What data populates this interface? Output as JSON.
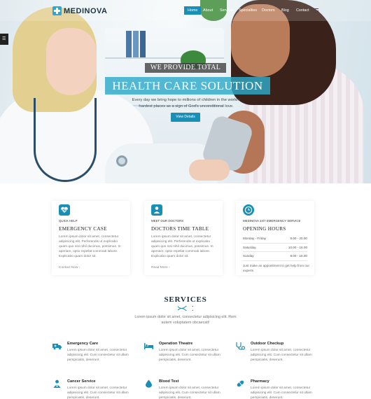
{
  "nav": {
    "logo": "MEDINOVA",
    "items": [
      "Home",
      "About",
      "Services",
      "Specialties",
      "Doctors",
      "Blog",
      "Contact"
    ],
    "active_index": 0
  },
  "hero": {
    "subtitle": "WE PROVIDE TOTAL",
    "title": "HEALTH CARE SOLUTION",
    "description": "Every day we bring hope to millions of children in the world's hardest places as a sign of God's unconditional love.",
    "button": "View Details"
  },
  "cards": [
    {
      "eyebrow": "QUICK HELP",
      "title": "EMERGENCY CASE",
      "text": "Lorem ipsum dolor sit amet, consectetur adipisicing elit. Perferendis ut explicabo quam quo nisi nihil ducimus, possimus. In aperiam, optio repellat commodi labore. Explicabo quam dolor sit.",
      "link": "Contact Now"
    },
    {
      "eyebrow": "MEET OUR DOCTORS",
      "title": "DOCTORS TIME TABLE",
      "text": "Lorem ipsum dolor sit amet, consectetur adipisicing elit. Perferendis ut explicabo quam quo nisi nihil ducimus, possimus. In aperiam, optio repellat commodi labore. Explicabo quam dolor sit.",
      "link": "Read More"
    },
    {
      "eyebrow": "MEDINOVA 24/7 EMERGENCY SERVICE",
      "title": "OPENING HOURS",
      "hours": [
        {
          "day": "Monday - Friday",
          "time": "8.00 - 20.00"
        },
        {
          "day": "Saturday",
          "time": "10.00 - 16.00"
        },
        {
          "day": "Sunday",
          "time": "8.00 - 16.00"
        }
      ],
      "note": "Just make an appointment to get help from our experts"
    }
  ],
  "services": {
    "title": "SERVICES",
    "description": "Lorem ipsum dolor sit amet, consectetur adipisicing elit. Rem autem voluptatem obcaecati!",
    "items": [
      {
        "name": "Emergency Care",
        "text": "Lorem ipsum dolor sit amet, consectetur adipisicing elit. Cum consectetur sit ullam perspiciatis, deserunt.",
        "icon": "ambulance-icon"
      },
      {
        "name": "Operation Theatre",
        "text": "Lorem ipsum dolor sit amet, consectetur adipisicing elit. Cum consectetur sit ullam perspiciatis, deserunt.",
        "icon": "bed-icon"
      },
      {
        "name": "Outdoor Checkup",
        "text": "Lorem ipsum dolor sit amet, consectetur adipisicing elit. Cum consectetur sit ullam perspiciatis, deserunt.",
        "icon": "stethoscope-icon"
      },
      {
        "name": "Cancer Service",
        "text": "Lorem ipsum dolor sit amet, consectetur adipisicing elit. Cum consectetur sit ullam perspiciatis, deserunt.",
        "icon": "doctor-icon"
      },
      {
        "name": "Blood Test",
        "text": "Lorem ipsum dolor sit amet, consectetur adipisicing elit. Cum consectetur sit ullam perspiciatis, deserunt.",
        "icon": "blood-drop-icon"
      },
      {
        "name": "Pharmacy",
        "text": "Lorem ipsum dolor sit amet, consectetur adipisicing elit. Cum consectetur sit ullam perspiciatis, deserunt.",
        "icon": "pill-icon"
      }
    ]
  },
  "colors": {
    "accent": "#1a8fb5",
    "hero_title_bg": "#2eaac9",
    "logo": "#26a8d8"
  }
}
